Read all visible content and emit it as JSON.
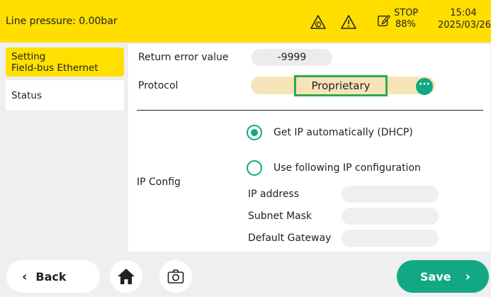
{
  "header": {
    "line_pressure": "Line pressure: 0.00bar",
    "status_top": "STOP",
    "status_bottom": "88%",
    "time": "15:04",
    "date": "2025/03/26",
    "icons": [
      "c-warning-icon",
      "warning-icon",
      "edit-icon"
    ],
    "bg_color": "#ffde00"
  },
  "sidebar": {
    "items": [
      {
        "line1": "Setting",
        "line2": "Field-bus Ethernet",
        "active": true
      },
      {
        "line1": "Status",
        "active": false
      }
    ]
  },
  "main": {
    "return_error_label": "Return error value",
    "return_error_value": "-9999",
    "protocol_label": "Protocol",
    "protocol_value": "Proprietary",
    "more_button": "···",
    "ip_config_label": "IP Config",
    "dhcp_label": "Get IP automatically (DHCP)",
    "static_label": "Use following IP configuration",
    "ip_address_label": "IP address",
    "subnet_label": "Subnet Mask",
    "gateway_label": "Default Gateway",
    "ip_address_value": "",
    "subnet_value": "",
    "gateway_value": "",
    "dhcp_selected": true
  },
  "footer": {
    "back_label": "Back",
    "save_label": "Save",
    "accent_color": "#12a884"
  }
}
